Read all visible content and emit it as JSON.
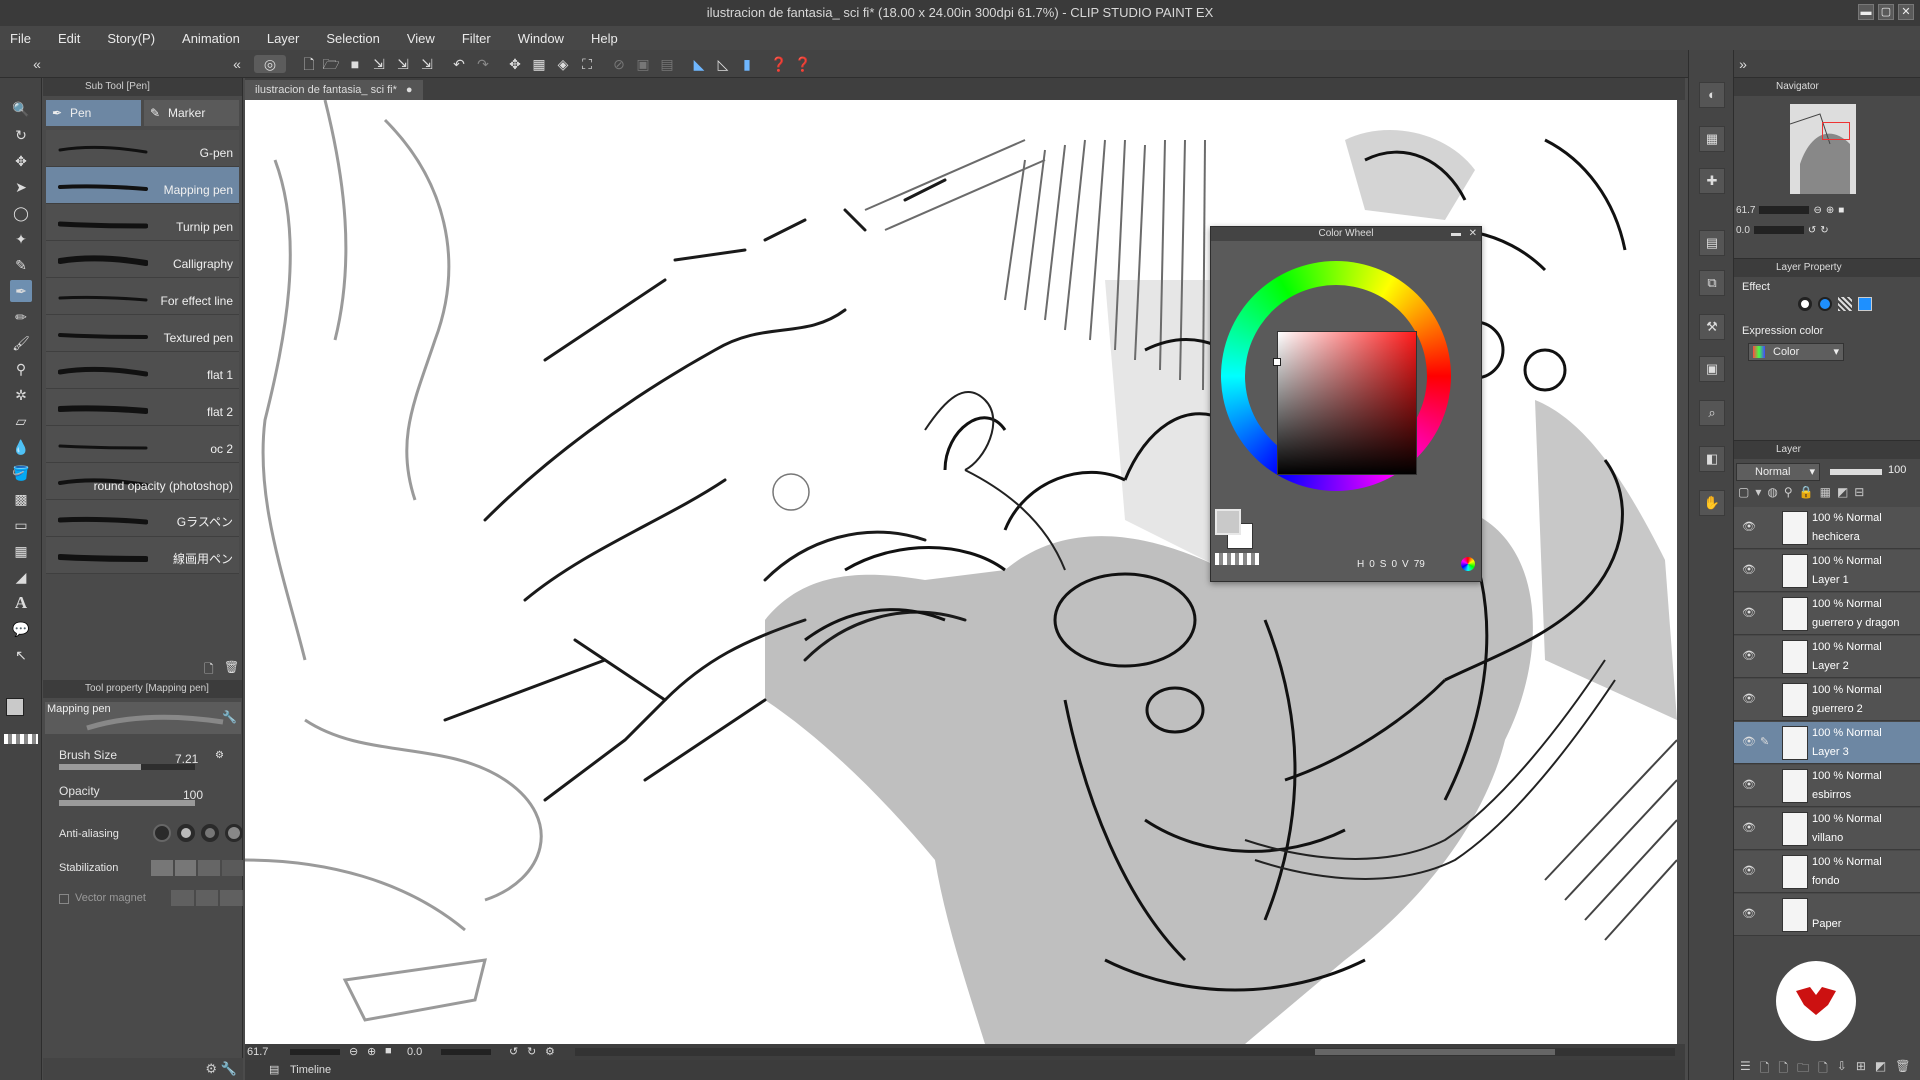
{
  "window": {
    "title": "ilustracion de fantasia_ sci fi* (18.00 x 24.00in 300dpi 61.7%) - CLIP STUDIO PAINT EX"
  },
  "menu": [
    "File",
    "Edit",
    "Story(P)",
    "Animation",
    "Layer",
    "Selection",
    "View",
    "Filter",
    "Window",
    "Help"
  ],
  "subtool": {
    "panel_title": "Sub Tool [Pen]",
    "tabs": [
      "Pen",
      "Marker"
    ],
    "brushes": [
      "G-pen",
      "Mapping pen",
      "Turnip pen",
      "Calligraphy",
      "For effect line",
      "Textured pen",
      "flat 1",
      "flat 2",
      "oc 2",
      "round opacity (photoshop)",
      "Gラスペン",
      "線画用ペン"
    ],
    "active_brush": "Mapping pen"
  },
  "toolprop": {
    "panel_title": "Tool property [Mapping pen]",
    "preview_label": "Mapping pen",
    "brush_size_label": "Brush Size",
    "brush_size_value": "7.21",
    "brush_size_level": 0.6,
    "opacity_label": "Opacity",
    "opacity_value": "100",
    "opacity_level": 1.0,
    "antialias_label": "Anti-aliasing",
    "stabilization_label": "Stabilization",
    "vector_magnet_label": "Vector magnet"
  },
  "document": {
    "tab_label": "ilustracion de fantasia_ sci fi*",
    "zoom": "61.7",
    "rotation": "0.0"
  },
  "timeline_label": "Timeline",
  "color_wheel": {
    "title": "Color Wheel",
    "h_label": "H",
    "h": "0",
    "s_label": "S",
    "s": "0",
    "v_label": "V",
    "v": "79",
    "main_color": "#c9c9c9"
  },
  "navigator": {
    "title": "Navigator",
    "zoom": "61.7",
    "rotation": "0.0"
  },
  "layer_property": {
    "title": "Layer Property",
    "effect_label": "Effect",
    "expression_color_label": "Expression color",
    "expression_color_value": "Color"
  },
  "layers": {
    "title": "Layer",
    "blend_mode": "Normal",
    "opacity": "100",
    "items": [
      {
        "mode": "100 % Normal",
        "name": "hechicera"
      },
      {
        "mode": "100 % Normal",
        "name": "Layer 1"
      },
      {
        "mode": "100 % Normal",
        "name": "guerrero y dragon"
      },
      {
        "mode": "100 % Normal",
        "name": "Layer 2"
      },
      {
        "mode": "100 % Normal",
        "name": "guerrero 2"
      },
      {
        "mode": "100 % Normal",
        "name": "Layer 3"
      },
      {
        "mode": "100 % Normal",
        "name": "esbirros"
      },
      {
        "mode": "100 % Normal",
        "name": "villano"
      },
      {
        "mode": "100 % Normal",
        "name": "fondo"
      },
      {
        "mode": "",
        "name": "Paper"
      }
    ],
    "active_layer": "Layer 3"
  },
  "colors": {
    "accent": "#6d87a3",
    "panel": "#4a4a4a",
    "logo_red": "#cc1111"
  }
}
